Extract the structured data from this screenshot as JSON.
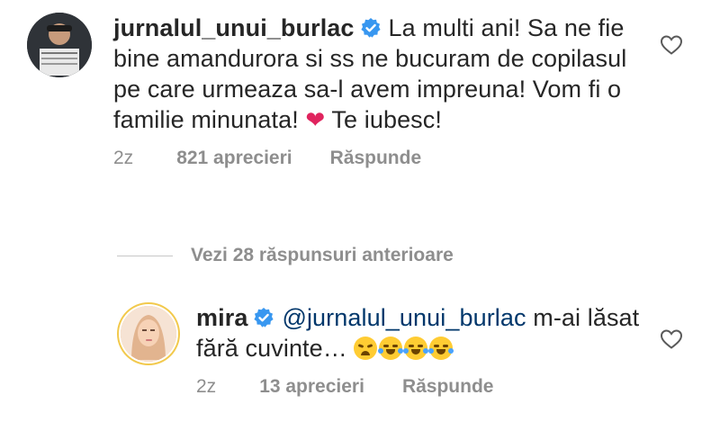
{
  "comments": [
    {
      "username": "jurnalul_unui_burlac",
      "text": "La multi ani! Sa ne fie bine amandurora si ss ne bucuram de copilasul pe care urmeaza sa-l avem impreuna! Vom fi o familie minunata!",
      "emoji": "❤",
      "text_end": "Te iubesc!",
      "time": "2z",
      "likes": "821 aprecieri",
      "reply": "Răspunde"
    },
    {
      "username": "mira",
      "mention": "@jurnalul_unui_burlac",
      "text": "m-ai lăsat fără cuvinte…",
      "time": "2z",
      "likes": "13 aprecieri",
      "reply": "Răspunde"
    }
  ],
  "replies_link": "Vezi 28 răspunsuri anterioare",
  "colors": {
    "verified": "#3897f0",
    "meta": "#8e8e8e",
    "mention": "#00376b",
    "heart": "#e0245e"
  }
}
